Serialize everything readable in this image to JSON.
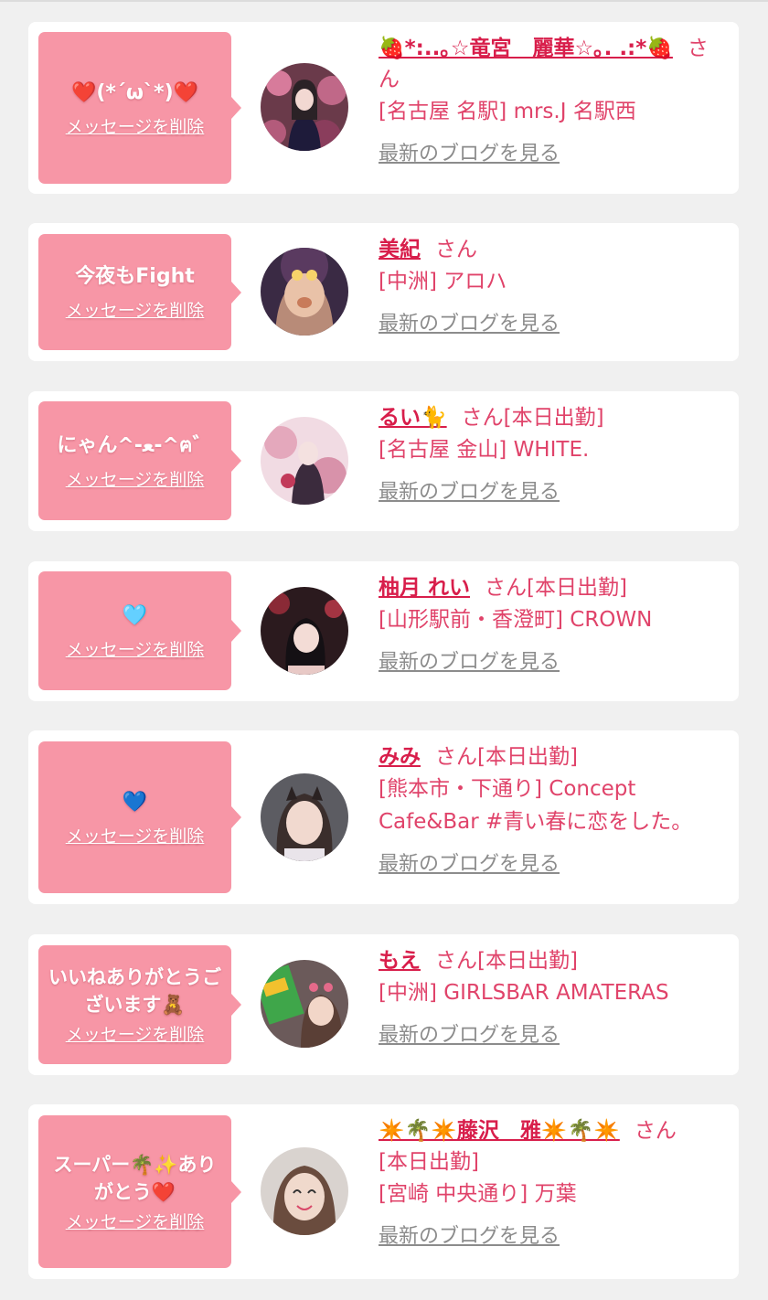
{
  "delete_label": "メッセージを削除",
  "blog_label": "最新のブログを見る",
  "san": "さん",
  "colors": {
    "bubble": "#f796a6",
    "name": "#d81e4b",
    "text": "#e0436a",
    "link": "#8c8c8c",
    "background": "#f0f0f0"
  },
  "cards": [
    {
      "message": "❤️(*´ω`*)❤️",
      "name": "🍓*:..｡☆竜宮　麗華☆｡. .:*🍓",
      "status": "",
      "shop": "[名古屋 名駅] mrs.J 名駅西",
      "avatar_icon": "profile-photo"
    },
    {
      "message": "今夜もFight",
      "name": "美紀",
      "status": "",
      "shop": "[中洲] アロハ",
      "avatar_icon": "profile-photo"
    },
    {
      "message": "にゃん^-ﻌ-^ฅ゛",
      "name": "るい🐈",
      "status": "[本日出勤]",
      "shop": "[名古屋 金山] WHITE.",
      "avatar_icon": "profile-photo"
    },
    {
      "message": "🩵",
      "name": "柚月 れい",
      "status": "[本日出勤]",
      "shop": "[山形駅前・香澄町] CROWN",
      "avatar_icon": "profile-photo"
    },
    {
      "message": "💙",
      "name": "みみ",
      "status": "[本日出勤]",
      "shop": "[熊本市・下通り] Concept Cafe&Bar #青い春に恋をした。",
      "avatar_icon": "profile-photo"
    },
    {
      "message": "いいねありがとうございます🧸",
      "name": "もえ",
      "status": "[本日出勤]",
      "shop": "[中洲] GIRLSBAR AMATERAS",
      "avatar_icon": "profile-photo"
    },
    {
      "message": "スーパー🌴✨ありがとう❤️",
      "name": "✴️🌴✴️藤沢　雅✴️🌴✴️",
      "status": "[本日出勤]",
      "shop": "[宮崎 中央通り] 万葉",
      "avatar_icon": "profile-photo"
    }
  ]
}
